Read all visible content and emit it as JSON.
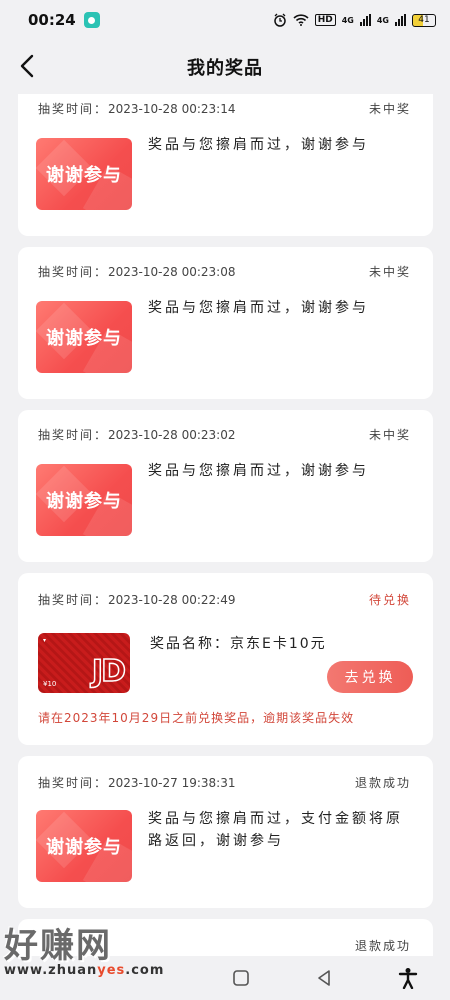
{
  "status_bar": {
    "time": "00:24",
    "hd": "HD",
    "net1": "4G",
    "net2": "4G",
    "battery": "41"
  },
  "header": {
    "title": "我的奖品"
  },
  "records": [
    {
      "time_label": "抽奖时间：",
      "time": "2023-10-28 00:23:14",
      "status": "未中奖",
      "thumb_text": "谢谢参与",
      "desc": "奖品与您擦肩而过，谢谢参与"
    },
    {
      "time_label": "抽奖时间：",
      "time": "2023-10-28 00:23:08",
      "status": "未中奖",
      "thumb_text": "谢谢参与",
      "desc": "奖品与您擦肩而过，谢谢参与"
    },
    {
      "time_label": "抽奖时间：",
      "time": "2023-10-28 00:23:02",
      "status": "未中奖",
      "thumb_text": "谢谢参与",
      "desc": "奖品与您擦肩而过，谢谢参与"
    }
  ],
  "prize_record": {
    "time_label": "抽奖时间：",
    "time": "2023-10-28 00:22:49",
    "status": "待兑换",
    "card_value": "¥10",
    "card_letters": "JD",
    "prize_name": "奖品名称：京东E卡10元",
    "redeem_button": "去兑换",
    "warning": "请在2023年10月29日之前兑换奖品，逾期该奖品失效"
  },
  "refund_record": {
    "time_label": "抽奖时间：",
    "time": "2023-10-27 19:38:31",
    "status": "退款成功",
    "thumb_text": "谢谢参与",
    "desc": "奖品与您擦肩而过，支付金额将原路返回，谢谢参与"
  },
  "partial_record": {
    "status": "退款成功"
  },
  "watermark": {
    "brand": "好赚网",
    "url_prefix": "www.zhuan",
    "url_highlight": "yes",
    "url_suffix": ".com"
  },
  "colors": {
    "accent_red": "#d2473a",
    "thumb_red": "#f54e4e",
    "background": "#f1f1f3"
  }
}
